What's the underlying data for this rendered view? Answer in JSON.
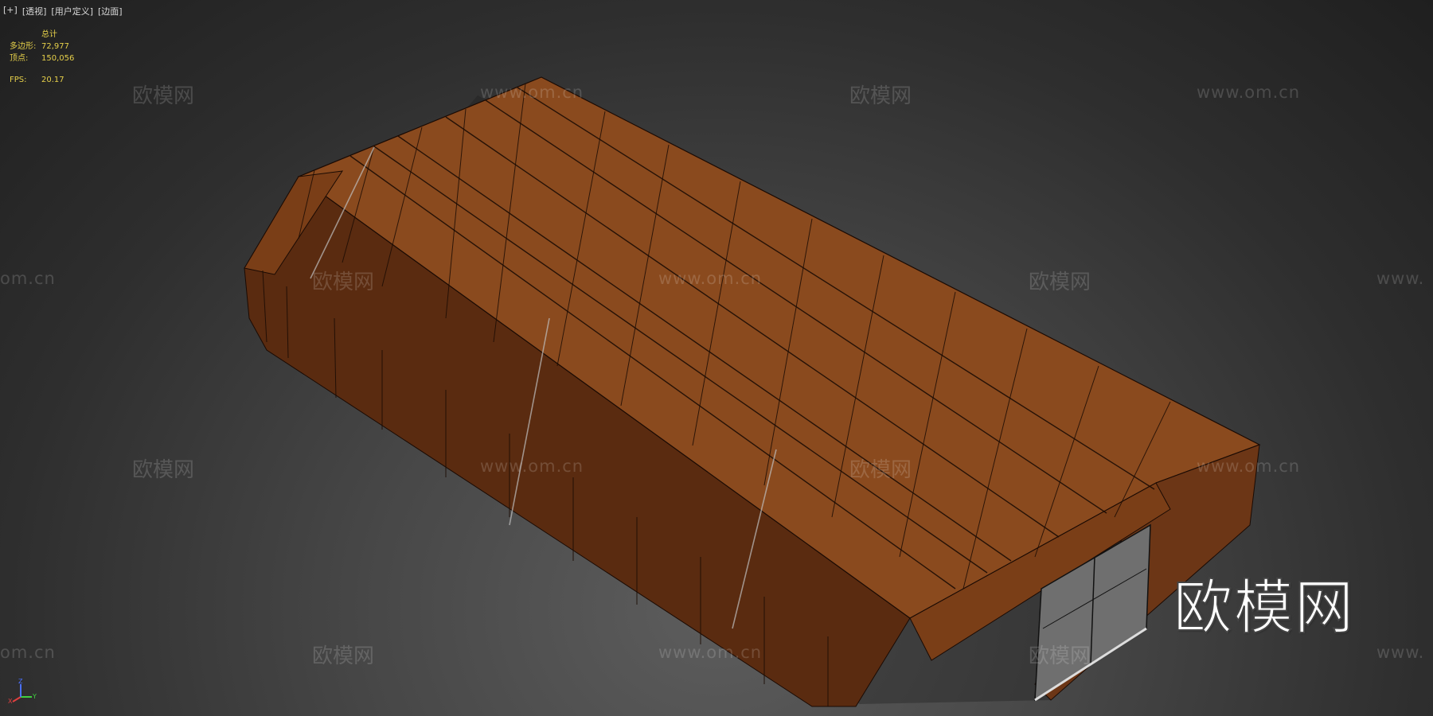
{
  "viewport_menu": {
    "plus": "[+]",
    "view": "[透视]",
    "shading_mode": "[用户定义]",
    "display_mode": "[边面]"
  },
  "stats": {
    "header": "总计",
    "polygons_label": "多边形:",
    "polygons_value": "72,977",
    "vertices_label": "顶点:",
    "vertices_value": "150,056",
    "fps_label": "FPS:",
    "fps_value": "20.17"
  },
  "watermark": {
    "brand": "欧模网",
    "url": "www.om.cn",
    "url_partial_right": "www.",
    "url_partial_left": "om.cn"
  },
  "axis_gizmo": {
    "x": "X",
    "y": "Y",
    "z": "Z"
  },
  "colors": {
    "model_top": "#8b4a1e",
    "model_side": "#6a3414",
    "wire": "#1c0c04",
    "stats": "#e6d04a"
  }
}
